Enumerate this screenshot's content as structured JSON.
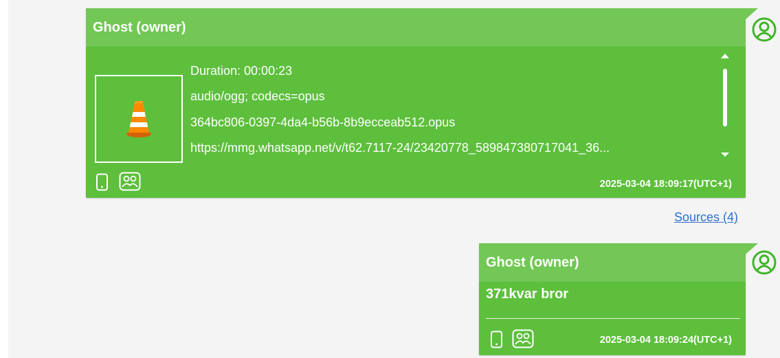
{
  "message1": {
    "sender": "Ghost (owner)",
    "duration": "Duration: 00:00:23",
    "mime": "audio/ogg; codecs=opus",
    "filename": "364bc806-0397-4da4-b56b-8b9ecceab512.opus",
    "url": "https://mmg.whatsapp.net/v/t62.7117-24/23420778_589847380717041_36...",
    "timestamp": "2025-03-04 18:09:17(UTC+1)",
    "thumb_icon": "vlc-cone-icon"
  },
  "sources_link": "Sources (4)",
  "message2": {
    "sender": "Ghost (owner)",
    "text": "371kvar bror",
    "timestamp": "2025-03-04 18:09:24(UTC+1)"
  },
  "colors": {
    "bubble": "#5dbf3c",
    "header": "#72c755",
    "avatar": "#3fb52a",
    "link": "#2b6fd0",
    "panel": "#f4f4f4"
  }
}
